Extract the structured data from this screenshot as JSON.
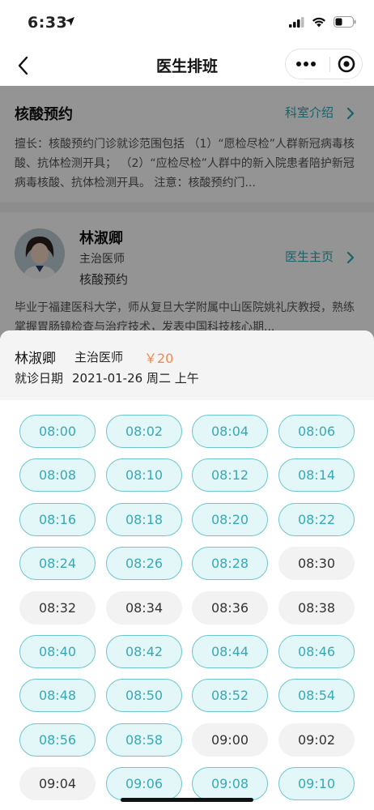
{
  "status_bar": {
    "time": "6:33"
  },
  "nav": {
    "title": "医生排班"
  },
  "department": {
    "name": "核酸预约",
    "link_label": "科室介绍",
    "description": "擅长：核酸预约门诊就诊范围包括 （1）“愿检尽检”人群新冠病毒核酸、抗体检测开具；  （2）“应检尽检”人群中的新入院患者陪护新冠病毒核酸、抗体检测开具。 注意：核酸预约门..."
  },
  "doctor": {
    "name": "林淑卿",
    "title": "主治医师",
    "department": "核酸预约",
    "link_label": "医生主页",
    "bio": "毕业于福建医科大学，师从复旦大学附属中山医院姚礼庆教授，熟练掌握胃肠镜检查与治疗技术，发表中国科技核心期..."
  },
  "sheet": {
    "doctor_name": "林淑卿",
    "doctor_title": "主治医师",
    "price": "￥20",
    "date_label": "就诊日期",
    "date_value": "2021-01-26 周二 上午"
  },
  "slots": [
    {
      "time": "08:00",
      "available": true
    },
    {
      "time": "08:02",
      "available": true
    },
    {
      "time": "08:04",
      "available": true
    },
    {
      "time": "08:06",
      "available": true
    },
    {
      "time": "08:08",
      "available": true
    },
    {
      "time": "08:10",
      "available": true
    },
    {
      "time": "08:12",
      "available": true
    },
    {
      "time": "08:14",
      "available": true
    },
    {
      "time": "08:16",
      "available": true
    },
    {
      "time": "08:18",
      "available": true
    },
    {
      "time": "08:20",
      "available": true
    },
    {
      "time": "08:22",
      "available": true
    },
    {
      "time": "08:24",
      "available": true
    },
    {
      "time": "08:26",
      "available": true
    },
    {
      "time": "08:28",
      "available": true
    },
    {
      "time": "08:30",
      "available": false
    },
    {
      "time": "08:32",
      "available": false
    },
    {
      "time": "08:34",
      "available": false
    },
    {
      "time": "08:36",
      "available": false
    },
    {
      "time": "08:38",
      "available": false
    },
    {
      "time": "08:40",
      "available": true
    },
    {
      "time": "08:42",
      "available": true
    },
    {
      "time": "08:44",
      "available": true
    },
    {
      "time": "08:46",
      "available": true
    },
    {
      "time": "08:48",
      "available": true
    },
    {
      "time": "08:50",
      "available": true
    },
    {
      "time": "08:52",
      "available": true
    },
    {
      "time": "08:54",
      "available": true
    },
    {
      "time": "08:56",
      "available": true
    },
    {
      "time": "08:58",
      "available": true
    },
    {
      "time": "09:00",
      "available": false
    },
    {
      "time": "09:02",
      "available": false
    },
    {
      "time": "09:04",
      "available": false
    },
    {
      "time": "09:06",
      "available": true
    },
    {
      "time": "09:08",
      "available": true
    },
    {
      "time": "09:10",
      "available": true
    }
  ],
  "colors": {
    "accent": "#2aa9b5",
    "slot_available_bg": "#e3f6f8",
    "slot_full_bg": "#f2f2f2",
    "price": "#f0894d"
  },
  "icons": [
    "location-arrow-icon",
    "signal-icon",
    "wifi-icon",
    "battery-icon",
    "back-arrow-icon",
    "more-dots-icon",
    "close-target-icon",
    "chevron-right-icon"
  ]
}
